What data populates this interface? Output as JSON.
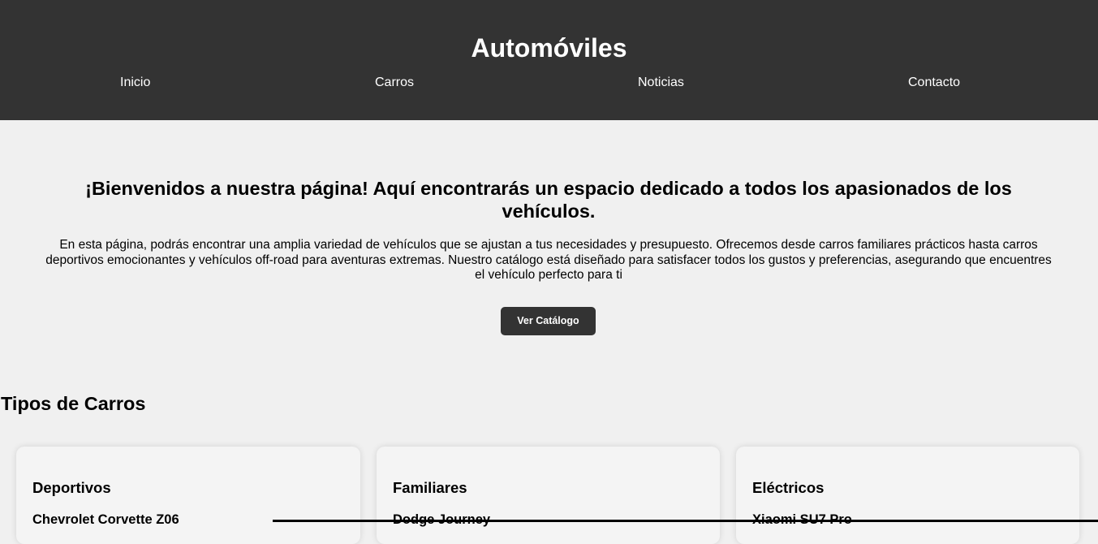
{
  "header": {
    "title": "Automóviles",
    "nav": [
      "Inicio",
      "Carros",
      "Noticias",
      "Contacto"
    ]
  },
  "hero": {
    "title": "¡Bienvenidos a nuestra página! Aquí encontrarás un espacio dedicado a todos los apasionados de los vehículos.",
    "text": "En esta página, podrás encontrar una amplia variedad de vehículos que se ajustan a tus necesidades y presupuesto. Ofrecemos desde carros familiares prácticos hasta carros deportivos emocionantes y vehículos off-road para aventuras extremas. Nuestro catálogo está diseñado para satisfacer todos los gustos y preferencias, asegurando que encuentres el vehículo perfecto para ti",
    "button_label": "Ver Catálogo"
  },
  "types": {
    "title": "Tipos de Carros",
    "cards": [
      {
        "title": "Deportivos",
        "item": "Chevrolet Corvette Z06"
      },
      {
        "title": "Familiares",
        "item": "Dodge Journey"
      },
      {
        "title": "Eléctricos",
        "item": "Xiaomi SU7 Pro"
      }
    ]
  },
  "colors": {
    "header_bg": "#333333",
    "page_bg": "#f0f0f0",
    "button_bg": "#333333",
    "card_bg": "#f4f4f4"
  }
}
